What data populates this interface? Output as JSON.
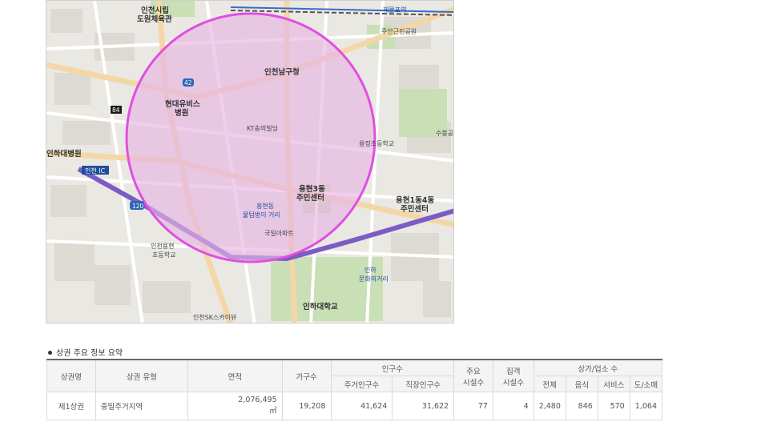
{
  "map": {
    "labels": {
      "city_hall": "인천시립\n도원체육관",
      "dong_hall": "인천남구청",
      "station": "제물포역",
      "hospital": "현대유비스\n병원",
      "kt_building": "KT송의빌딩",
      "yonghyeon3": "용현3동\n주민센터",
      "yonghyeon14": "용현1동4동\n주민센터",
      "inha_univ": "인하대학교",
      "inha_culture": "인하\n문화의거리",
      "market": "용현동\n물텀벙이 거리",
      "inha_hospital": "인하대병원",
      "ic": "인천 IC",
      "route_120": "120",
      "route_42": "42",
      "route_84": "84",
      "sky_tower": "인천SK스카이뷰",
      "gugil_apt": "국일아파트",
      "sugbong": "수봉공",
      "yongjeong_school": "용정초등학교",
      "yonghyeon_school": "인천용현\n초등학교",
      "park": "주안근린공원"
    }
  },
  "section_title": "상권 주요 정보 요약",
  "table": {
    "headers": {
      "name": "상권명",
      "type": "상권 유형",
      "area": "면적",
      "households": "가구수",
      "population": "인구수",
      "residents": "주거인구수",
      "workers": "직장인구수",
      "facilities": "주요\n시설수",
      "attract": "집객\n시설수",
      "stores": "상가/업소 수",
      "total": "전체",
      "food": "음식",
      "service": "서비스",
      "retail": "도/소매"
    },
    "row": {
      "name": "제1상권",
      "type": "중밀주거지역",
      "area": "2,076,495",
      "area_unit": "㎡",
      "households": "19,208",
      "residents": "41,624",
      "workers": "31,622",
      "facilities": "77",
      "attract": "4",
      "total": "2,480",
      "food": "846",
      "service": "570",
      "retail": "1,064"
    }
  },
  "colors": {
    "circle_stroke": "#e04fe0",
    "circle_fill": "#e7b6e4",
    "highway": "#7c5cc4",
    "major_road": "#f3d7a8",
    "table_header_bg": "#f4f4f4"
  }
}
